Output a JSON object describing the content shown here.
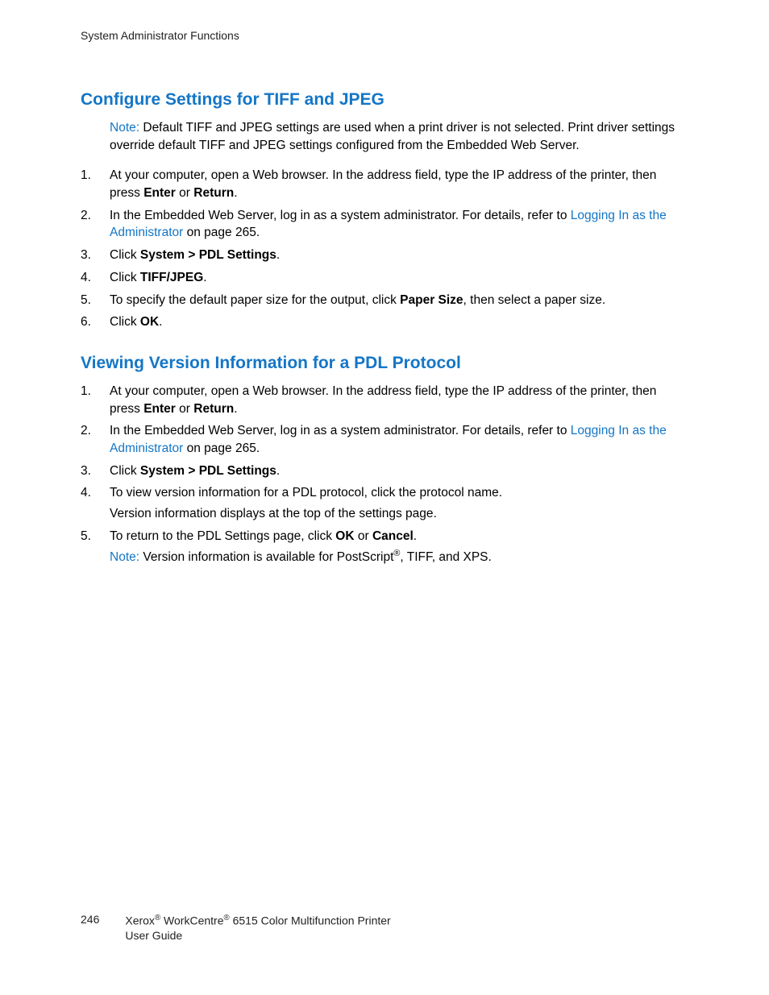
{
  "header": {
    "running": "System Administrator Functions"
  },
  "sectionA": {
    "title": "Configure Settings for TIFF and JPEG",
    "noteLabel": "Note:",
    "noteText": " Default TIFF and JPEG settings are used when a print driver is not selected. Print driver settings override default TIFF and JPEG settings configured from the Embedded Web Server.",
    "s1a": "At your computer, open a Web browser. In the address field, type the IP address of the printer, then press ",
    "s1b_bold": "Enter",
    "s1c": " or ",
    "s1d_bold": "Return",
    "s1e": ".",
    "s2a": "In the Embedded Web Server, log in as a system administrator. For details, refer to ",
    "s2link": "Logging In as the Administrator",
    "s2b": " on page 265.",
    "s3a": "Click ",
    "s3b_bold": "System > PDL Settings",
    "s3c": ".",
    "s4a": "Click ",
    "s4b_bold": "TIFF/JPEG",
    "s4c": ".",
    "s5a": "To specify the default paper size for the output, click ",
    "s5b_bold": "Paper Size",
    "s5c": ", then select a paper size.",
    "s6a": "Click ",
    "s6b_bold": "OK",
    "s6c": "."
  },
  "sectionB": {
    "title": "Viewing Version Information for a PDL Protocol",
    "s1a": "At your computer, open a Web browser. In the address field, type the IP address of the printer, then press ",
    "s1b_bold": "Enter",
    "s1c": " or ",
    "s1d_bold": "Return",
    "s1e": ".",
    "s2a": "In the Embedded Web Server, log in as a system administrator. For details, refer to ",
    "s2link": "Logging In as the Administrator",
    "s2b": " on page 265.",
    "s3a": "Click ",
    "s3b_bold": "System > PDL Settings",
    "s3c": ".",
    "s4a": "To view version information for a PDL protocol, click the protocol name.",
    "s4sub": "Version information displays at the top of the settings page.",
    "s5a": "To return to the PDL Settings page, click ",
    "s5b_bold": "OK",
    "s5c": " or ",
    "s5d_bold": "Cancel",
    "s5e": ".",
    "noteLabel": "Note:",
    "noteText_a": " Version information is available for PostScript",
    "noteText_b": ", TIFF, and XPS."
  },
  "footer": {
    "page": "246",
    "prod_a": "Xerox",
    "prod_b": " WorkCentre",
    "prod_c": " 6515 Color Multifunction Printer",
    "guide": "User Guide"
  }
}
